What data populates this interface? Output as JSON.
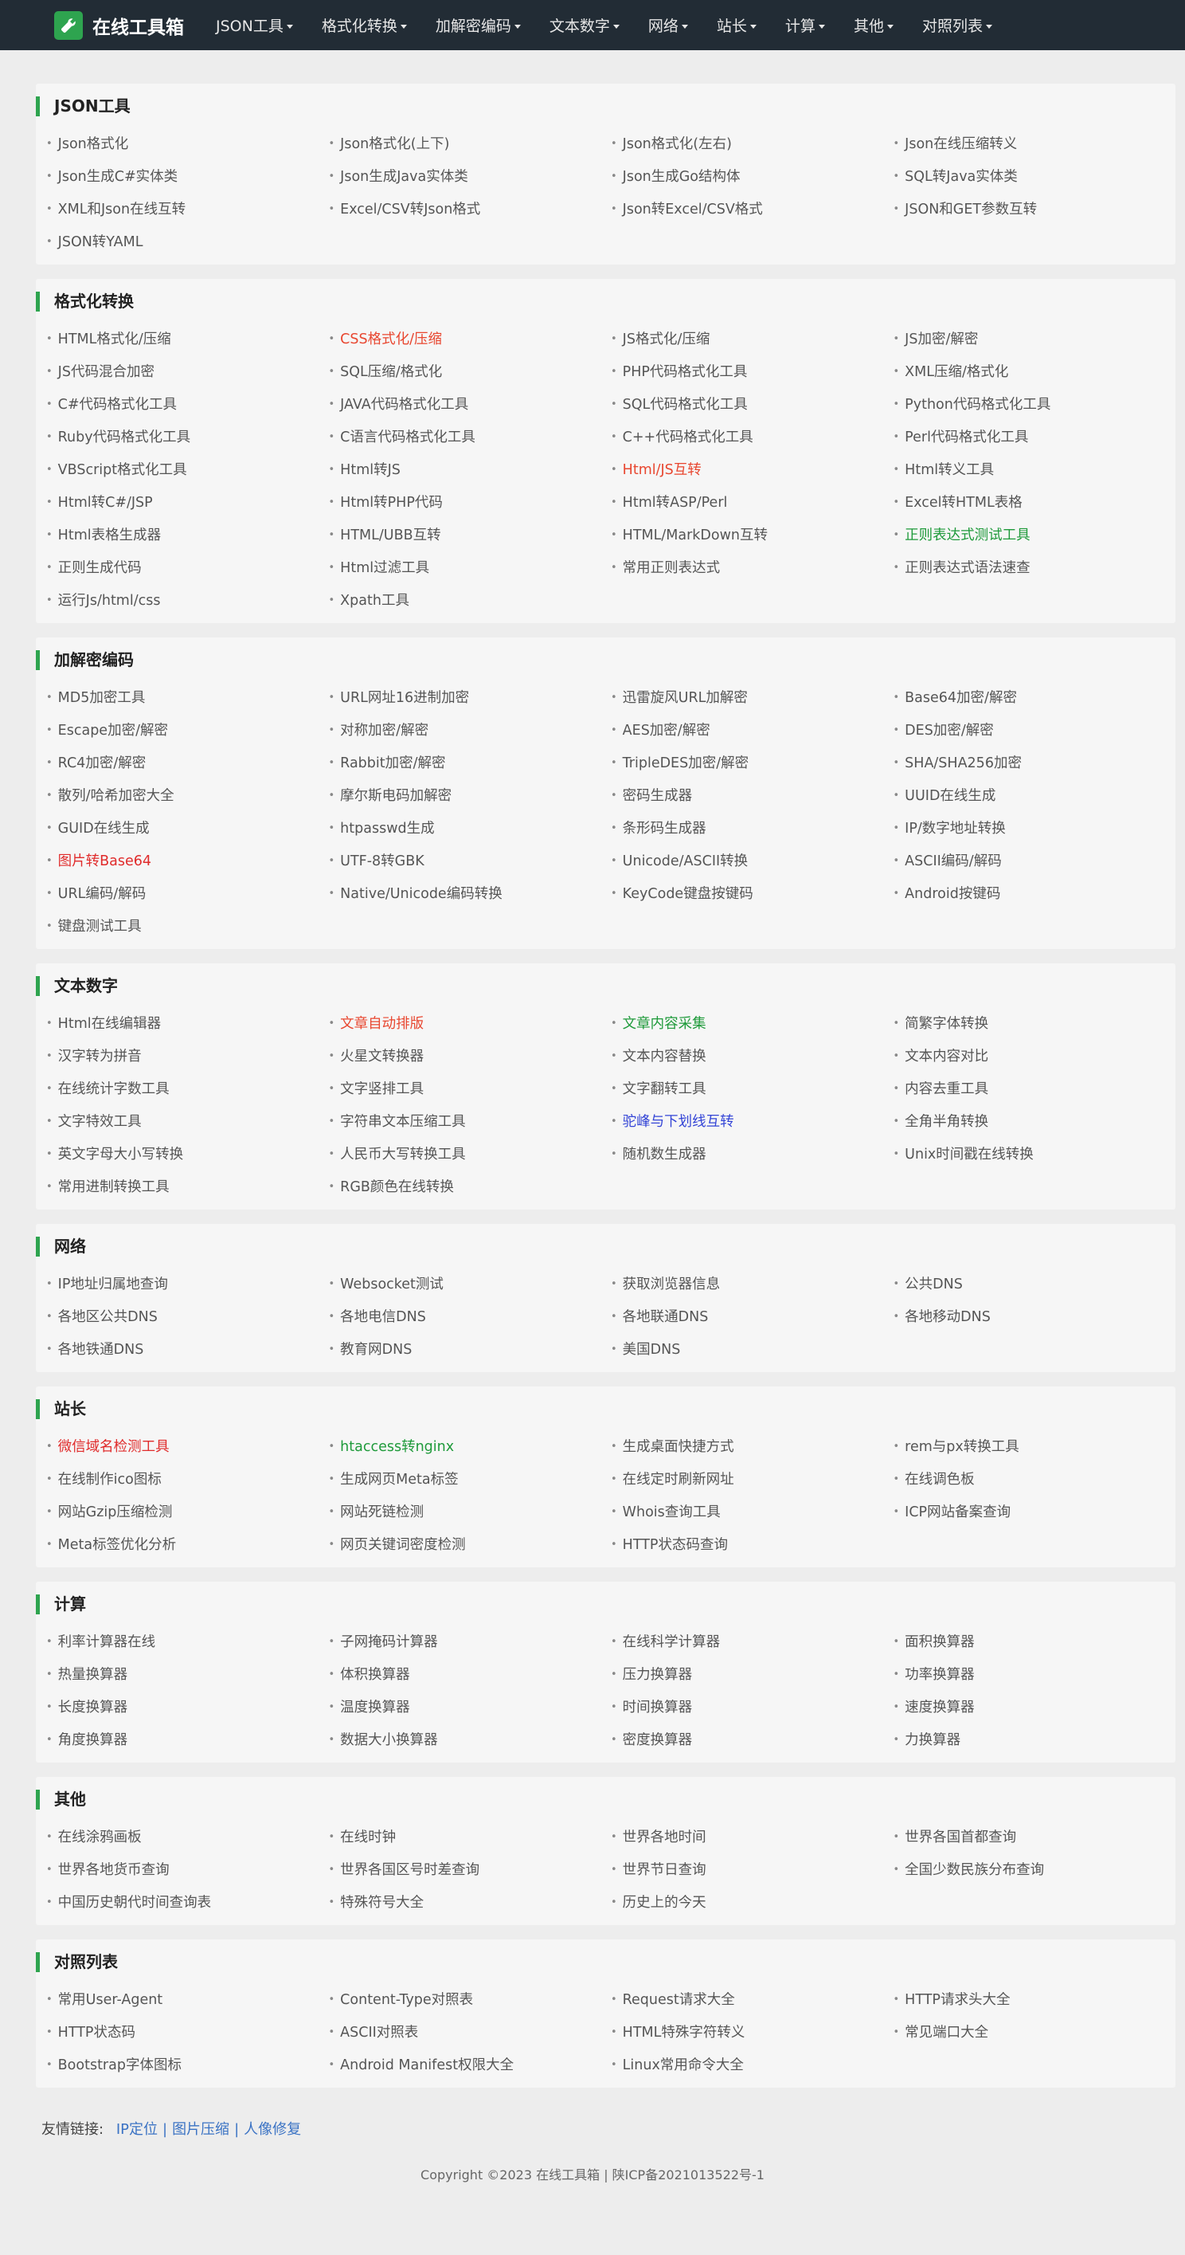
{
  "header": {
    "brand": "在线工具箱",
    "nav": [
      "JSON工具",
      "格式化转换",
      "加解密编码",
      "文本数字",
      "网络",
      "站长",
      "计算",
      "其他",
      "对照列表"
    ]
  },
  "sections": [
    {
      "title": "JSON工具",
      "tools": [
        {
          "label": "Json格式化"
        },
        {
          "label": "Json格式化(上下)"
        },
        {
          "label": "Json格式化(左右)"
        },
        {
          "label": "Json在线压缩转义"
        },
        {
          "label": "Json生成C#实体类"
        },
        {
          "label": "Json生成Java实体类"
        },
        {
          "label": "Json生成Go结构体"
        },
        {
          "label": "SQL转Java实体类"
        },
        {
          "label": "XML和Json在线互转"
        },
        {
          "label": "Excel/CSV转Json格式"
        },
        {
          "label": "Json转Excel/CSV格式"
        },
        {
          "label": "JSON和GET参数互转"
        },
        {
          "label": "JSON转YAML"
        }
      ]
    },
    {
      "title": "格式化转换",
      "tools": [
        {
          "label": "HTML格式化/压缩"
        },
        {
          "label": "CSS格式化/压缩",
          "color": "#e8462f"
        },
        {
          "label": "JS格式化/压缩"
        },
        {
          "label": "JS加密/解密"
        },
        {
          "label": "JS代码混合加密"
        },
        {
          "label": "SQL压缩/格式化"
        },
        {
          "label": "PHP代码格式化工具"
        },
        {
          "label": "XML压缩/格式化"
        },
        {
          "label": "C#代码格式化工具"
        },
        {
          "label": "JAVA代码格式化工具"
        },
        {
          "label": "SQL代码格式化工具"
        },
        {
          "label": "Python代码格式化工具"
        },
        {
          "label": "Ruby代码格式化工具"
        },
        {
          "label": "C语言代码格式化工具"
        },
        {
          "label": "C++代码格式化工具"
        },
        {
          "label": "Perl代码格式化工具"
        },
        {
          "label": "VBScript格式化工具"
        },
        {
          "label": "Html转JS"
        },
        {
          "label": "Html/JS互转",
          "color": "#e8462f"
        },
        {
          "label": "Html转义工具"
        },
        {
          "label": "Html转C#/JSP"
        },
        {
          "label": "Html转PHP代码"
        },
        {
          "label": "Html转ASP/Perl"
        },
        {
          "label": "Excel转HTML表格"
        },
        {
          "label": "Html表格生成器"
        },
        {
          "label": "HTML/UBB互转"
        },
        {
          "label": "HTML/MarkDown互转"
        },
        {
          "label": "正则表达式测试工具",
          "color": "#1e9a3a"
        },
        {
          "label": "正则生成代码"
        },
        {
          "label": "Html过滤工具"
        },
        {
          "label": "常用正则表达式"
        },
        {
          "label": "正则表达式语法速查"
        },
        {
          "label": "运行Js/html/css"
        },
        {
          "label": "Xpath工具"
        }
      ]
    },
    {
      "title": "加解密编码",
      "tools": [
        {
          "label": "MD5加密工具"
        },
        {
          "label": "URL网址16进制加密"
        },
        {
          "label": "迅雷旋风URL加解密"
        },
        {
          "label": "Base64加密/解密"
        },
        {
          "label": "Escape加密/解密"
        },
        {
          "label": "对称加密/解密"
        },
        {
          "label": "AES加密/解密"
        },
        {
          "label": "DES加密/解密"
        },
        {
          "label": "RC4加密/解密"
        },
        {
          "label": "Rabbit加密/解密"
        },
        {
          "label": "TripleDES加密/解密"
        },
        {
          "label": "SHA/SHA256加密"
        },
        {
          "label": "散列/哈希加密大全"
        },
        {
          "label": "摩尔斯电码加解密"
        },
        {
          "label": "密码生成器"
        },
        {
          "label": "UUID在线生成"
        },
        {
          "label": "GUID在线生成"
        },
        {
          "label": "htpasswd生成"
        },
        {
          "label": "条形码生成器"
        },
        {
          "label": "IP/数字地址转换"
        },
        {
          "label": "图片转Base64",
          "color": "#e02b2b"
        },
        {
          "label": "UTF-8转GBK"
        },
        {
          "label": "Unicode/ASCII转换"
        },
        {
          "label": "ASCII编码/解码"
        },
        {
          "label": "URL编码/解码"
        },
        {
          "label": "Native/Unicode编码转换"
        },
        {
          "label": "KeyCode键盘按键码"
        },
        {
          "label": "Android按键码"
        },
        {
          "label": "键盘测试工具"
        }
      ]
    },
    {
      "title": "文本数字",
      "tools": [
        {
          "label": "Html在线编辑器"
        },
        {
          "label": "文章自动排版",
          "color": "#e8462f"
        },
        {
          "label": "文章内容采集",
          "color": "#1e9a3a"
        },
        {
          "label": "简繁字体转换"
        },
        {
          "label": "汉字转为拼音"
        },
        {
          "label": "火星文转换器"
        },
        {
          "label": "文本内容替换"
        },
        {
          "label": "文本内容对比"
        },
        {
          "label": "在线统计字数工具"
        },
        {
          "label": "文字竖排工具"
        },
        {
          "label": "文字翻转工具"
        },
        {
          "label": "内容去重工具"
        },
        {
          "label": "文字特效工具"
        },
        {
          "label": "字符串文本压缩工具"
        },
        {
          "label": "驼峰与下划线互转",
          "color": "#3344d6"
        },
        {
          "label": "全角半角转换"
        },
        {
          "label": "英文字母大小写转换"
        },
        {
          "label": "人民币大写转换工具"
        },
        {
          "label": "随机数生成器"
        },
        {
          "label": "Unix时间戳在线转换"
        },
        {
          "label": "常用进制转换工具"
        },
        {
          "label": "RGB颜色在线转换"
        }
      ]
    },
    {
      "title": "网络",
      "tools": [
        {
          "label": "IP地址归属地查询"
        },
        {
          "label": "Websocket测试"
        },
        {
          "label": "获取浏览器信息"
        },
        {
          "label": "公共DNS"
        },
        {
          "label": "各地区公共DNS"
        },
        {
          "label": "各地电信DNS"
        },
        {
          "label": "各地联通DNS"
        },
        {
          "label": "各地移动DNS"
        },
        {
          "label": "各地铁通DNS"
        },
        {
          "label": "教育网DNS"
        },
        {
          "label": "美国DNS"
        }
      ]
    },
    {
      "title": "站长",
      "tools": [
        {
          "label": "微信域名检测工具",
          "color": "#e02b2b"
        },
        {
          "label": "htaccess转nginx",
          "color": "#1e9a3a"
        },
        {
          "label": "生成桌面快捷方式"
        },
        {
          "label": "rem与px转换工具"
        },
        {
          "label": "在线制作ico图标"
        },
        {
          "label": "生成网页Meta标签"
        },
        {
          "label": "在线定时刷新网址"
        },
        {
          "label": "在线调色板"
        },
        {
          "label": "网站Gzip压缩检测"
        },
        {
          "label": "网站死链检测"
        },
        {
          "label": "Whois查询工具"
        },
        {
          "label": "ICP网站备案查询"
        },
        {
          "label": "Meta标签优化分析"
        },
        {
          "label": "网页关键词密度检测"
        },
        {
          "label": "HTTP状态码查询"
        }
      ]
    },
    {
      "title": "计算",
      "tools": [
        {
          "label": "利率计算器在线"
        },
        {
          "label": "子网掩码计算器"
        },
        {
          "label": "在线科学计算器"
        },
        {
          "label": "面积换算器"
        },
        {
          "label": "热量换算器"
        },
        {
          "label": "体积换算器"
        },
        {
          "label": "压力换算器"
        },
        {
          "label": "功率换算器"
        },
        {
          "label": "长度换算器"
        },
        {
          "label": "温度换算器"
        },
        {
          "label": "时间换算器"
        },
        {
          "label": "速度换算器"
        },
        {
          "label": "角度换算器"
        },
        {
          "label": "数据大小换算器"
        },
        {
          "label": "密度换算器"
        },
        {
          "label": "力换算器"
        }
      ]
    },
    {
      "title": "其他",
      "tools": [
        {
          "label": "在线涂鸦画板"
        },
        {
          "label": "在线时钟"
        },
        {
          "label": "世界各地时间"
        },
        {
          "label": "世界各国首都查询"
        },
        {
          "label": "世界各地货币查询"
        },
        {
          "label": "世界各国区号时差查询"
        },
        {
          "label": "世界节日查询"
        },
        {
          "label": "全国少数民族分布查询"
        },
        {
          "label": "中国历史朝代时间查询表"
        },
        {
          "label": "特殊符号大全"
        },
        {
          "label": "历史上的今天"
        }
      ]
    },
    {
      "title": "对照列表",
      "tools": [
        {
          "label": "常用User-Agent"
        },
        {
          "label": "Content-Type对照表"
        },
        {
          "label": "Request请求大全"
        },
        {
          "label": "HTTP请求头大全"
        },
        {
          "label": "HTTP状态码"
        },
        {
          "label": "ASCII对照表"
        },
        {
          "label": "HTML特殊字符转义"
        },
        {
          "label": "常见端口大全"
        },
        {
          "label": "Bootstrap字体图标"
        },
        {
          "label": "Android Manifest权限大全"
        },
        {
          "label": "Linux常用命令大全"
        }
      ]
    }
  ],
  "footer": {
    "links_label": "友情链接:",
    "links": [
      "IP定位",
      "图片压缩",
      "人像修复"
    ],
    "separator": "|",
    "copyright": "Copyright ©2023 在线工具箱 | 陕ICP备2021013522号-1"
  },
  "icons": {
    "brand": "wrench-icon",
    "nav_dropdown": "caret-down-icon"
  },
  "colors": {
    "navbar": "#222c35",
    "accent": "#2ea44f",
    "link": "#3b73c4"
  }
}
